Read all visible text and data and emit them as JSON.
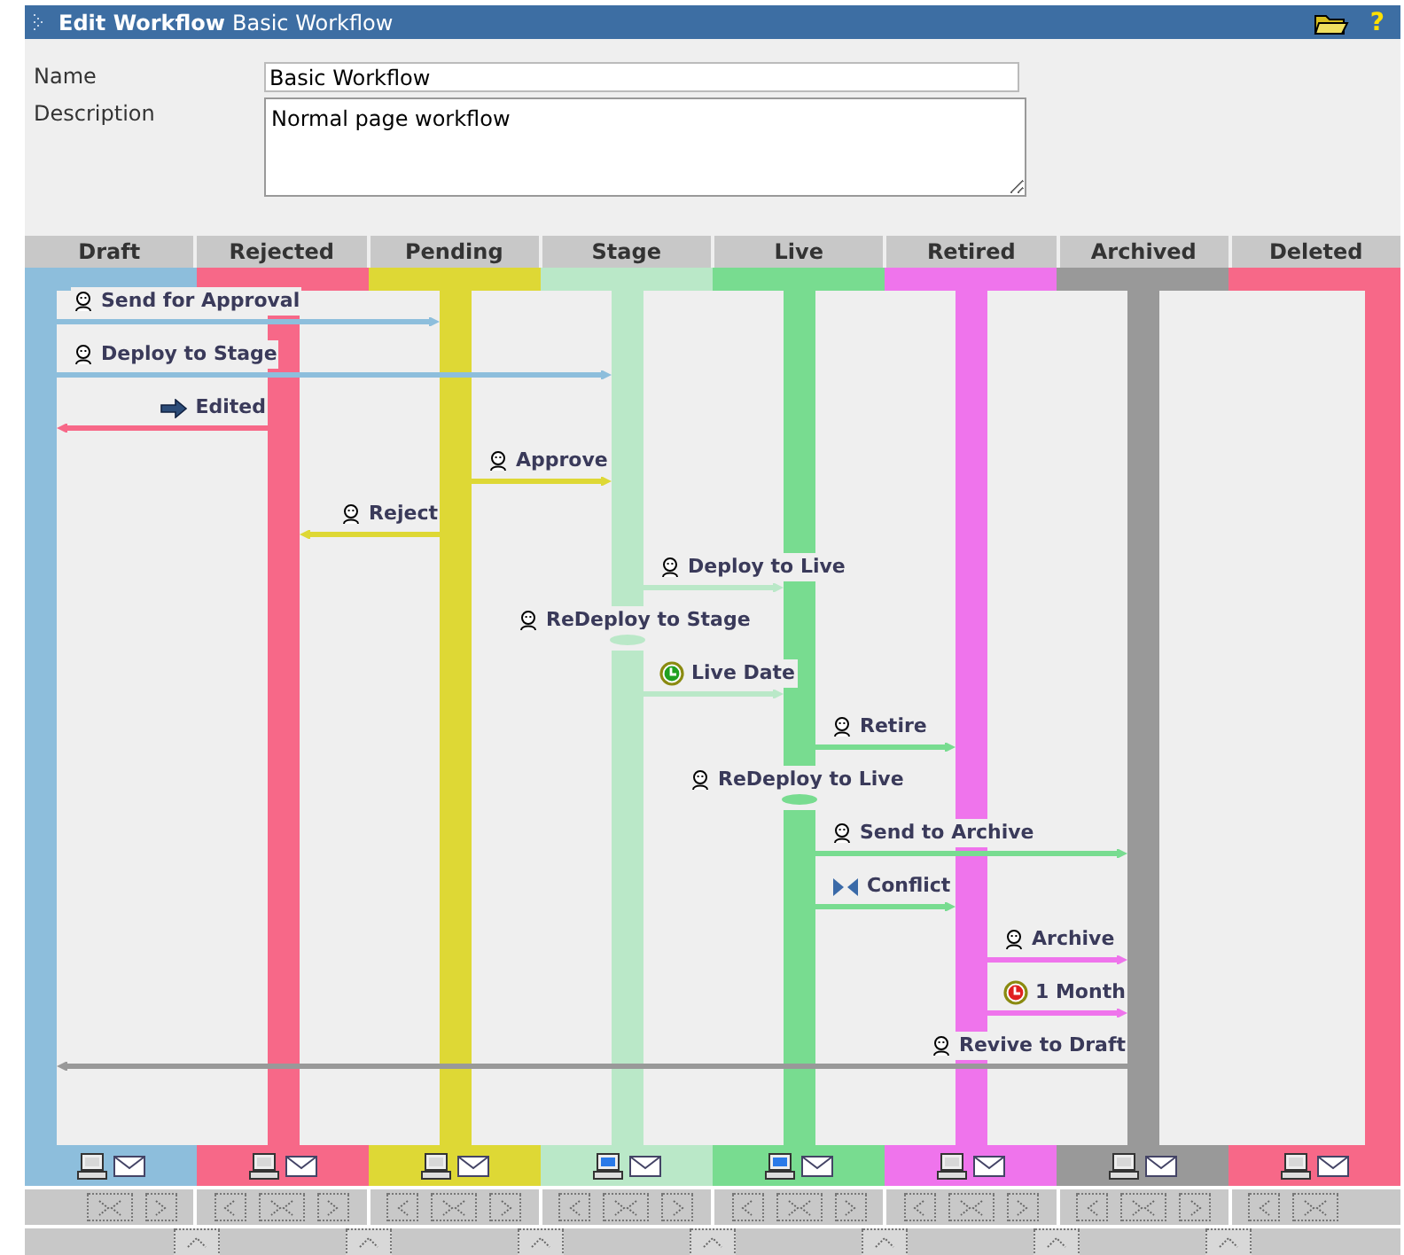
{
  "title_bar": {
    "heading": "Edit Workflow",
    "name": "Basic Workflow",
    "help": "?"
  },
  "form": {
    "name_label": "Name",
    "name_value": "Basic Workflow",
    "description_label": "Description",
    "description_value": "Normal page workflow"
  },
  "states": [
    {
      "name": "Draft",
      "color": "#8dbedc",
      "screen_active": false
    },
    {
      "name": "Rejected",
      "color": "#f76888",
      "screen_active": false
    },
    {
      "name": "Pending",
      "color": "#ded835",
      "screen_active": false
    },
    {
      "name": "Stage",
      "color": "#bae8c8",
      "screen_active": true
    },
    {
      "name": "Live",
      "color": "#78dc90",
      "screen_active": true
    },
    {
      "name": "Retired",
      "color": "#ef74ec",
      "screen_active": false
    },
    {
      "name": "Archived",
      "color": "#999999",
      "screen_active": false
    },
    {
      "name": "Deleted",
      "color": "#f76888",
      "screen_active": false
    }
  ],
  "transitions": [
    {
      "label": "Send for Approval",
      "kind": "user",
      "lanes": [
        {
          "kind": "start"
        },
        {
          "kind": "pass"
        },
        {
          "kind": "end"
        },
        {
          "kind": "none"
        },
        {
          "kind": "none"
        },
        {
          "kind": "none"
        },
        {
          "kind": "none"
        },
        {
          "kind": "none"
        }
      ]
    },
    {
      "label": "Deploy to Stage",
      "kind": "user",
      "lanes": [
        {
          "kind": "start"
        },
        {
          "kind": "pass"
        },
        {
          "kind": "pass"
        },
        {
          "kind": "end"
        },
        {
          "kind": "none"
        },
        {
          "kind": "none"
        },
        {
          "kind": "none"
        },
        {
          "kind": "none"
        }
      ]
    },
    {
      "label": "Edited",
      "kind": "arrow",
      "lanes": [
        {
          "kind": "end"
        },
        {
          "kind": "start"
        },
        {
          "kind": "none"
        },
        {
          "kind": "none"
        },
        {
          "kind": "none"
        },
        {
          "kind": "none"
        },
        {
          "kind": "none"
        },
        {
          "kind": "none"
        }
      ]
    },
    {
      "label": "Approve",
      "kind": "user",
      "lanes": [
        {
          "kind": "none"
        },
        {
          "kind": "none"
        },
        {
          "kind": "start"
        },
        {
          "kind": "end"
        },
        {
          "kind": "none"
        },
        {
          "kind": "none"
        },
        {
          "kind": "none"
        },
        {
          "kind": "none"
        }
      ]
    },
    {
      "label": "Reject",
      "kind": "user",
      "lanes": [
        {
          "kind": "none"
        },
        {
          "kind": "end"
        },
        {
          "kind": "start"
        },
        {
          "kind": "none"
        },
        {
          "kind": "none"
        },
        {
          "kind": "none"
        },
        {
          "kind": "none"
        },
        {
          "kind": "none"
        }
      ]
    },
    {
      "label": "Deploy to Live",
      "kind": "user",
      "lanes": [
        {
          "kind": "none"
        },
        {
          "kind": "none"
        },
        {
          "kind": "none"
        },
        {
          "kind": "start"
        },
        {
          "kind": "end"
        },
        {
          "kind": "none"
        },
        {
          "kind": "none"
        },
        {
          "kind": "none"
        }
      ]
    },
    {
      "label": "ReDeploy to Stage",
      "kind": "user",
      "lanes": [
        {
          "kind": "none"
        },
        {
          "kind": "none"
        },
        {
          "kind": "none"
        },
        {
          "kind": "loop"
        },
        {
          "kind": "none"
        },
        {
          "kind": "none"
        },
        {
          "kind": "none"
        },
        {
          "kind": "none"
        }
      ]
    },
    {
      "label": "Live Date",
      "kind": "clock-green",
      "lanes": [
        {
          "kind": "none"
        },
        {
          "kind": "none"
        },
        {
          "kind": "none"
        },
        {
          "kind": "start"
        },
        {
          "kind": "end"
        },
        {
          "kind": "none"
        },
        {
          "kind": "none"
        },
        {
          "kind": "none"
        }
      ]
    },
    {
      "label": "Retire",
      "kind": "user",
      "lanes": [
        {
          "kind": "none"
        },
        {
          "kind": "none"
        },
        {
          "kind": "none"
        },
        {
          "kind": "none"
        },
        {
          "kind": "start"
        },
        {
          "kind": "end"
        },
        {
          "kind": "none"
        },
        {
          "kind": "none"
        }
      ]
    },
    {
      "label": "ReDeploy to Live",
      "kind": "user",
      "lanes": [
        {
          "kind": "none"
        },
        {
          "kind": "none"
        },
        {
          "kind": "none"
        },
        {
          "kind": "none"
        },
        {
          "kind": "loop"
        },
        {
          "kind": "none"
        },
        {
          "kind": "none"
        },
        {
          "kind": "none"
        }
      ]
    },
    {
      "label": "Send to Archive",
      "kind": "user",
      "lanes": [
        {
          "kind": "none"
        },
        {
          "kind": "none"
        },
        {
          "kind": "none"
        },
        {
          "kind": "none"
        },
        {
          "kind": "start"
        },
        {
          "kind": "pass"
        },
        {
          "kind": "end"
        },
        {
          "kind": "none"
        }
      ]
    },
    {
      "label": "Conflict",
      "kind": "conflict",
      "lanes": [
        {
          "kind": "none"
        },
        {
          "kind": "none"
        },
        {
          "kind": "none"
        },
        {
          "kind": "none"
        },
        {
          "kind": "start"
        },
        {
          "kind": "end"
        },
        {
          "kind": "none"
        },
        {
          "kind": "none"
        }
      ]
    },
    {
      "label": "Archive",
      "kind": "user",
      "lanes": [
        {
          "kind": "none"
        },
        {
          "kind": "none"
        },
        {
          "kind": "none"
        },
        {
          "kind": "none"
        },
        {
          "kind": "none"
        },
        {
          "kind": "start"
        },
        {
          "kind": "end"
        },
        {
          "kind": "none"
        }
      ]
    },
    {
      "label": "1 Month",
      "kind": "clock-red",
      "lanes": [
        {
          "kind": "none"
        },
        {
          "kind": "none"
        },
        {
          "kind": "none"
        },
        {
          "kind": "none"
        },
        {
          "kind": "none"
        },
        {
          "kind": "start"
        },
        {
          "kind": "end"
        },
        {
          "kind": "none"
        }
      ]
    },
    {
      "label": "Revive to Draft",
      "kind": "user",
      "lanes": [
        {
          "kind": "end"
        },
        {
          "kind": "pass"
        },
        {
          "kind": "pass"
        },
        {
          "kind": "pass"
        },
        {
          "kind": "pass"
        },
        {
          "kind": "pass"
        },
        {
          "kind": "start"
        },
        {
          "kind": "none"
        }
      ]
    }
  ]
}
